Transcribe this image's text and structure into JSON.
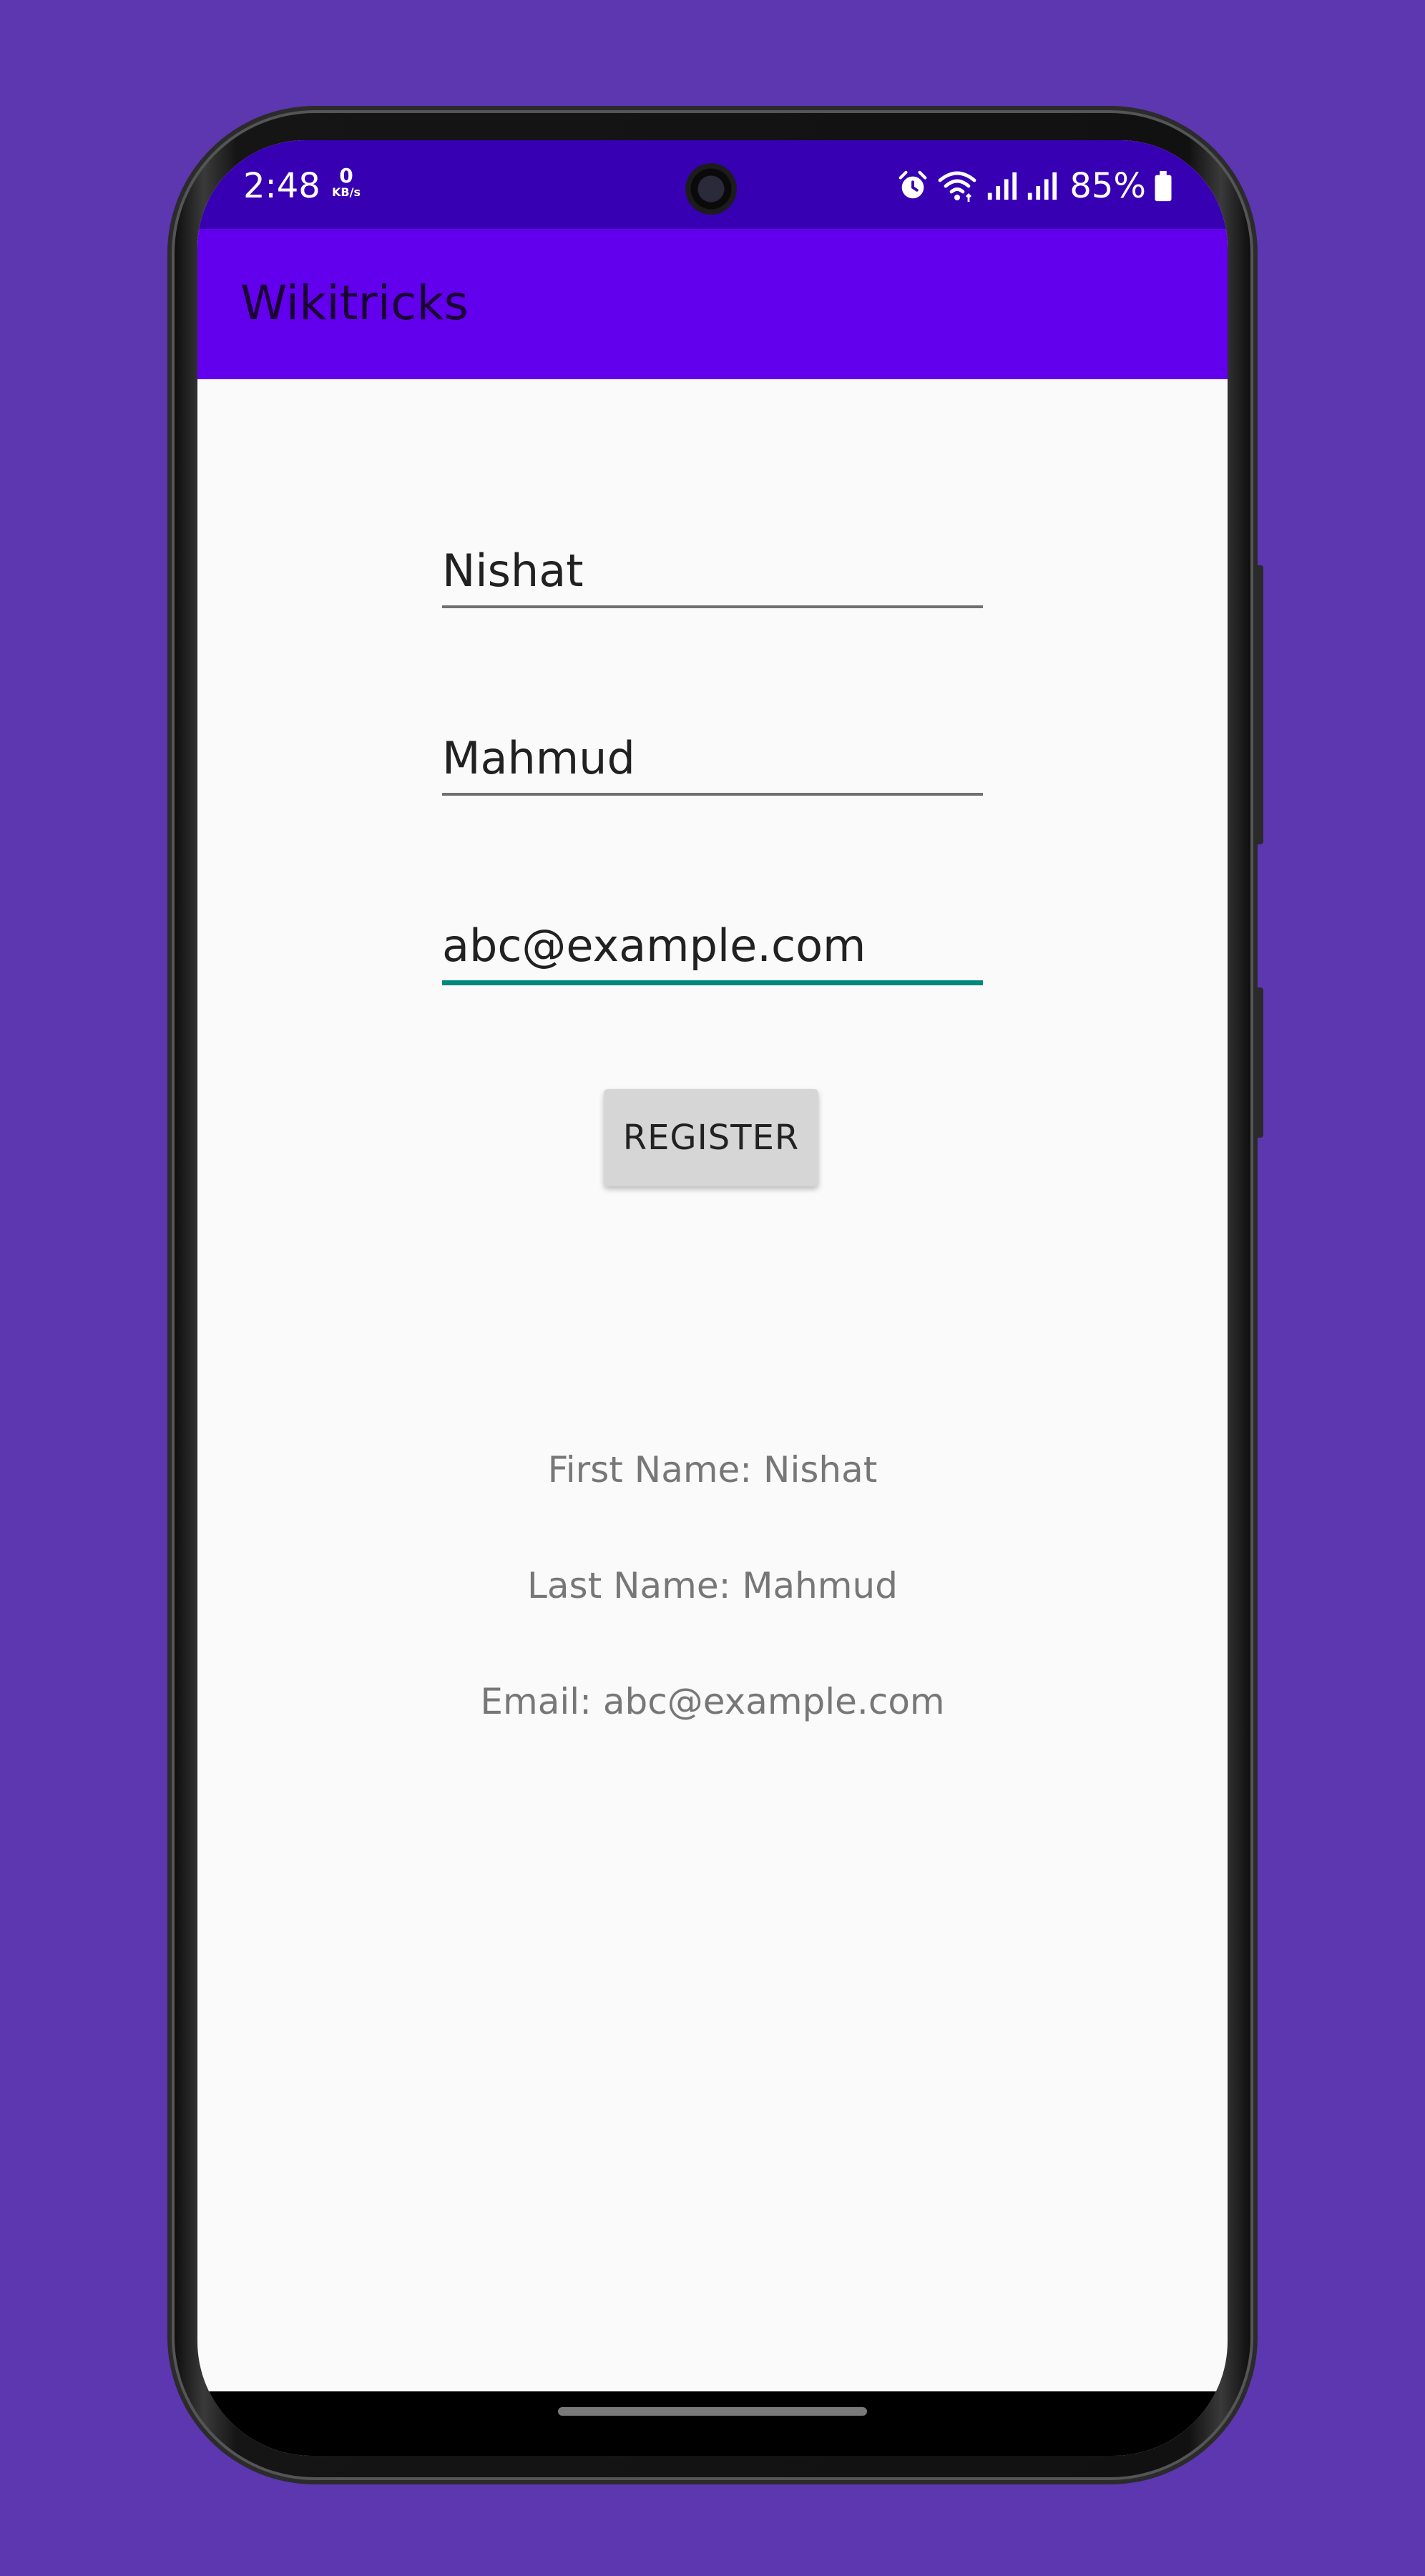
{
  "status_bar": {
    "time": "2:48",
    "network_speed_value": "0",
    "network_speed_unit": "KB/s",
    "battery_percent": "85%",
    "icons": [
      "alarm-icon",
      "wifi-icon",
      "signal-icon",
      "signal-icon",
      "battery-icon"
    ]
  },
  "app_bar": {
    "title": "Wikitricks"
  },
  "form": {
    "first_name_value": "Nishat",
    "last_name_value": "Mahmud",
    "email_value": "abc@example.com",
    "register_label": "REGISTER"
  },
  "results": {
    "first_name": "First Name: Nishat",
    "last_name": "Last Name: Mahmud",
    "email": "Email: abc@example.com"
  },
  "colors": {
    "background": "#5c37b0",
    "status_bar": "#3700b3",
    "app_bar": "#6200ee",
    "focused_underline": "#00897b"
  }
}
